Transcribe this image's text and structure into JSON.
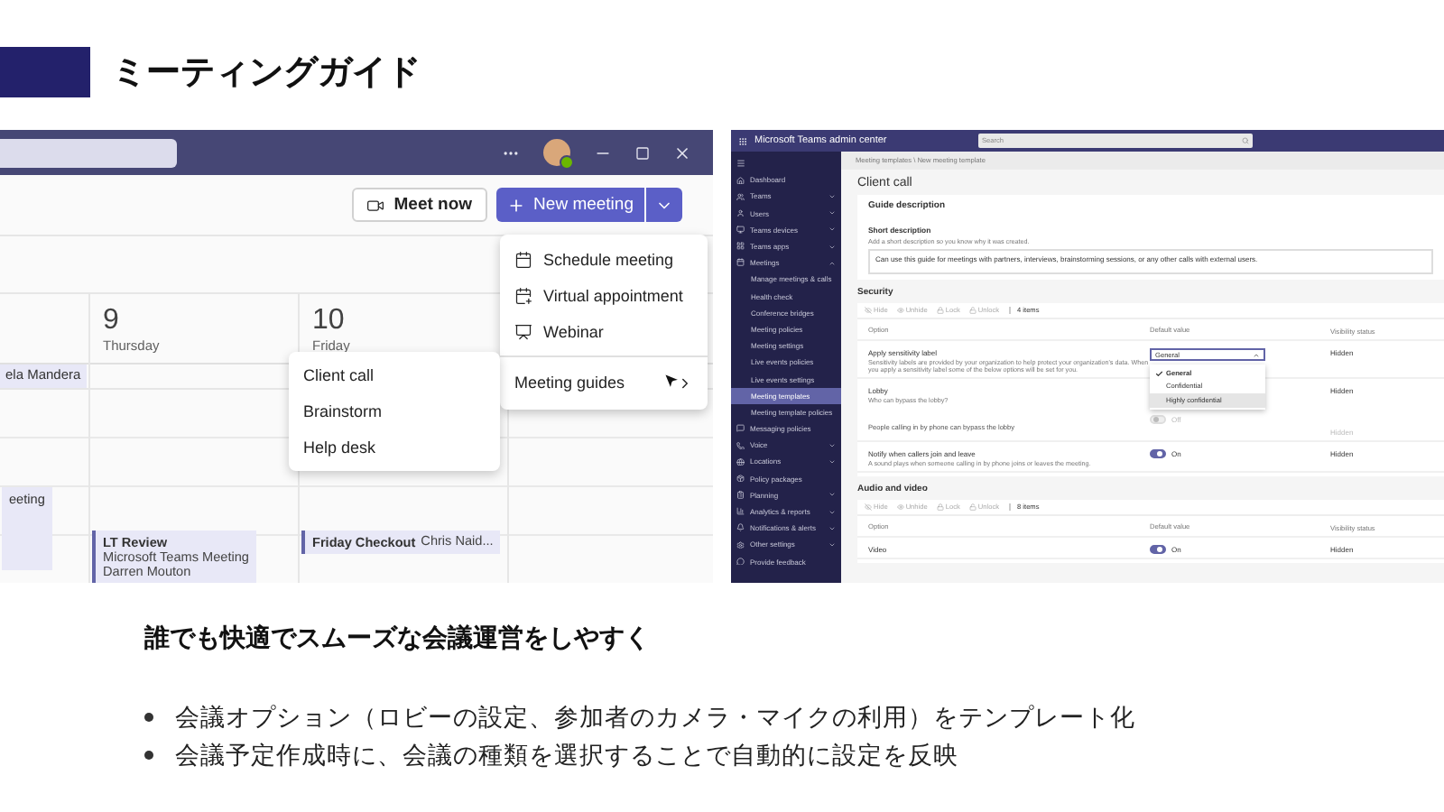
{
  "title": "ミーティングガイド",
  "teams_window": {
    "meet_now": "Meet now",
    "new_meeting": "New meeting",
    "columns": [
      {
        "all_day": "ela Mandera",
        "events": [
          {
            "title": "eeting"
          }
        ]
      },
      {
        "number": "9",
        "weekday": "Thursday",
        "events": [
          {
            "title": "LT Review",
            "lines": [
              "Microsoft Teams Meeting",
              "Darren Mouton"
            ]
          }
        ]
      },
      {
        "number": "10",
        "weekday": "Friday",
        "events": [
          {
            "title": "Friday Checkout",
            "lines": [
              "Chris Naid..."
            ]
          }
        ]
      }
    ],
    "menu": {
      "items": [
        "Schedule meeting",
        "Virtual appointment",
        "Webinar"
      ],
      "guides": {
        "label": "Meeting guides",
        "expanded": true,
        "items": [
          "Client call",
          "Brainstorm",
          "Help desk"
        ]
      }
    }
  },
  "admin_center": {
    "app_title": "Microsoft Teams admin center",
    "search": {
      "placeholder": "Search"
    },
    "nav": [
      {
        "label": "Dashboard",
        "kind": "link",
        "selected": false
      },
      {
        "label": "Teams",
        "kind": "group",
        "expanded": false,
        "selected": false
      },
      {
        "label": "Users",
        "kind": "group",
        "expanded": false,
        "selected": false
      },
      {
        "label": "Teams devices",
        "kind": "group",
        "expanded": false,
        "selected": false
      },
      {
        "label": "Teams apps",
        "kind": "group",
        "expanded": false,
        "selected": false
      },
      {
        "label": "Meetings",
        "kind": "group",
        "expanded": true,
        "selected": false,
        "children": [
          {
            "label": "Manage meetings & calls",
            "selected": false
          },
          {
            "label": "Health check",
            "selected": false
          },
          {
            "label": "Conference bridges",
            "selected": false
          },
          {
            "label": "Meeting policies",
            "selected": false
          },
          {
            "label": "Meeting settings",
            "selected": false
          },
          {
            "label": "Live events policies",
            "selected": false
          },
          {
            "label": "Live events settings",
            "selected": false
          },
          {
            "label": "Meeting templates",
            "selected": true
          },
          {
            "label": "Meeting template policies",
            "selected": false
          }
        ]
      },
      {
        "label": "Messaging policies",
        "kind": "link",
        "selected": false
      },
      {
        "label": "Voice",
        "kind": "group",
        "expanded": false,
        "selected": false
      },
      {
        "label": "Locations",
        "kind": "group",
        "expanded": false,
        "selected": false
      },
      {
        "label": "Policy packages",
        "kind": "link",
        "selected": false
      },
      {
        "label": "Planning",
        "kind": "group",
        "expanded": false,
        "selected": false
      },
      {
        "label": "Analytics & reports",
        "kind": "group",
        "expanded": false,
        "selected": false
      },
      {
        "label": "Notifications & alerts",
        "kind": "group",
        "expanded": false,
        "selected": false
      },
      {
        "label": "Other settings",
        "kind": "group",
        "expanded": false,
        "selected": false
      },
      {
        "label": "Provide feedback",
        "kind": "link",
        "selected": false
      }
    ],
    "breadcrumb": "Meeting templates \\ New meeting template",
    "page_title": "Client call",
    "guide": {
      "heading": "Guide description",
      "label": "Short description",
      "hint": "Add a short description so you know why it was created.",
      "value": "Can use this guide for meetings with partners, interviews, brainstorming sessions, or any other calls with external users."
    },
    "sections": [
      {
        "heading": "Security",
        "toolbar": [
          {
            "label": "Hide"
          },
          {
            "label": "Unhide"
          },
          {
            "label": "Lock"
          },
          {
            "label": "Unlock"
          }
        ],
        "count": "4 items",
        "columns": [
          "Option",
          "Default value",
          "Visibility status"
        ],
        "rows": [
          {
            "kind": "dropdown",
            "option": "Apply sensitivity label",
            "description": "Sensitivity labels are provided by your organization to help protect your organization's data. When you apply a sensitivity label some of the below options will be set for you.",
            "value": "General",
            "open": true,
            "options": [
              {
                "label": "General",
                "selected": true,
                "hovered": false
              },
              {
                "label": "Confidential",
                "selected": false,
                "hovered": false
              },
              {
                "label": "Highly confidential",
                "selected": false,
                "hovered": true
              }
            ],
            "visibility": "Hidden"
          },
          {
            "kind": "dropdown",
            "option": "Lobby",
            "description": "Who can bypass the lobby?",
            "visibility": "Hidden",
            "sub": {
              "label": "People calling in by phone can bypass the lobby",
              "on": false,
              "disabled": true,
              "state_text": "Off",
              "visibility": "Hidden"
            }
          },
          {
            "kind": "toggle",
            "option": "Notify when callers join and leave",
            "description": "A sound plays when someone calling in by phone joins or leaves the meeting.",
            "on": true,
            "state_text": "On",
            "visibility": "Hidden"
          }
        ]
      },
      {
        "heading": "Audio and video",
        "toolbar": [
          {
            "label": "Hide"
          },
          {
            "label": "Unhide"
          },
          {
            "label": "Lock"
          },
          {
            "label": "Unlock"
          }
        ],
        "count": "8 items",
        "columns": [
          "Option",
          "Default value",
          "Visibility status"
        ],
        "rows": [
          {
            "kind": "toggle",
            "option": "Video",
            "on": true,
            "state_text": "On",
            "visibility": "Hidden"
          }
        ]
      }
    ]
  },
  "slogan": "誰でも快適でスムーズな会議運営をしやすく",
  "bullets": [
    "会議オプション（ロビーの設定、参加者のカメラ・マイクの利用）をテンプレート化",
    "会議予定作成時に、会議の種類を選択することで自動的に設定を反映"
  ]
}
